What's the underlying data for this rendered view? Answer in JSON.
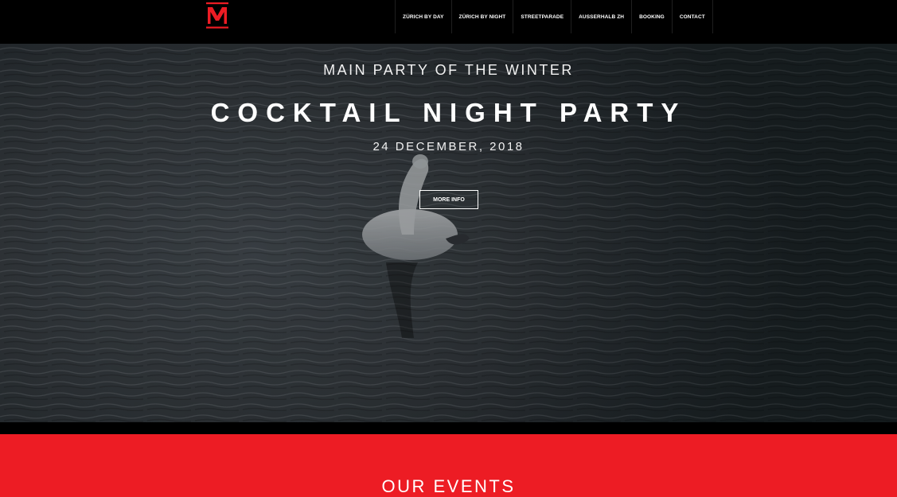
{
  "brand": {
    "accent_color": "#ed1c24",
    "logo_icon": "m-monogram-logo-icon"
  },
  "nav": {
    "items": [
      {
        "label": "ZÜRICH BY DAY"
      },
      {
        "label": "ZÜRICH BY NIGHT"
      },
      {
        "label": "STREETPARADE"
      },
      {
        "label": "AUSSERHALB ZH"
      },
      {
        "label": "BOOKING"
      },
      {
        "label": "CONTACT"
      }
    ]
  },
  "hero": {
    "subtitle": "MAIN PARTY OF THE WINTER",
    "title": "COCKTAIL NIGHT PARTY",
    "date": "24 DECEMBER, 2018",
    "button_label": "MORE INFO"
  },
  "events": {
    "title": "OUR EVENTS"
  }
}
